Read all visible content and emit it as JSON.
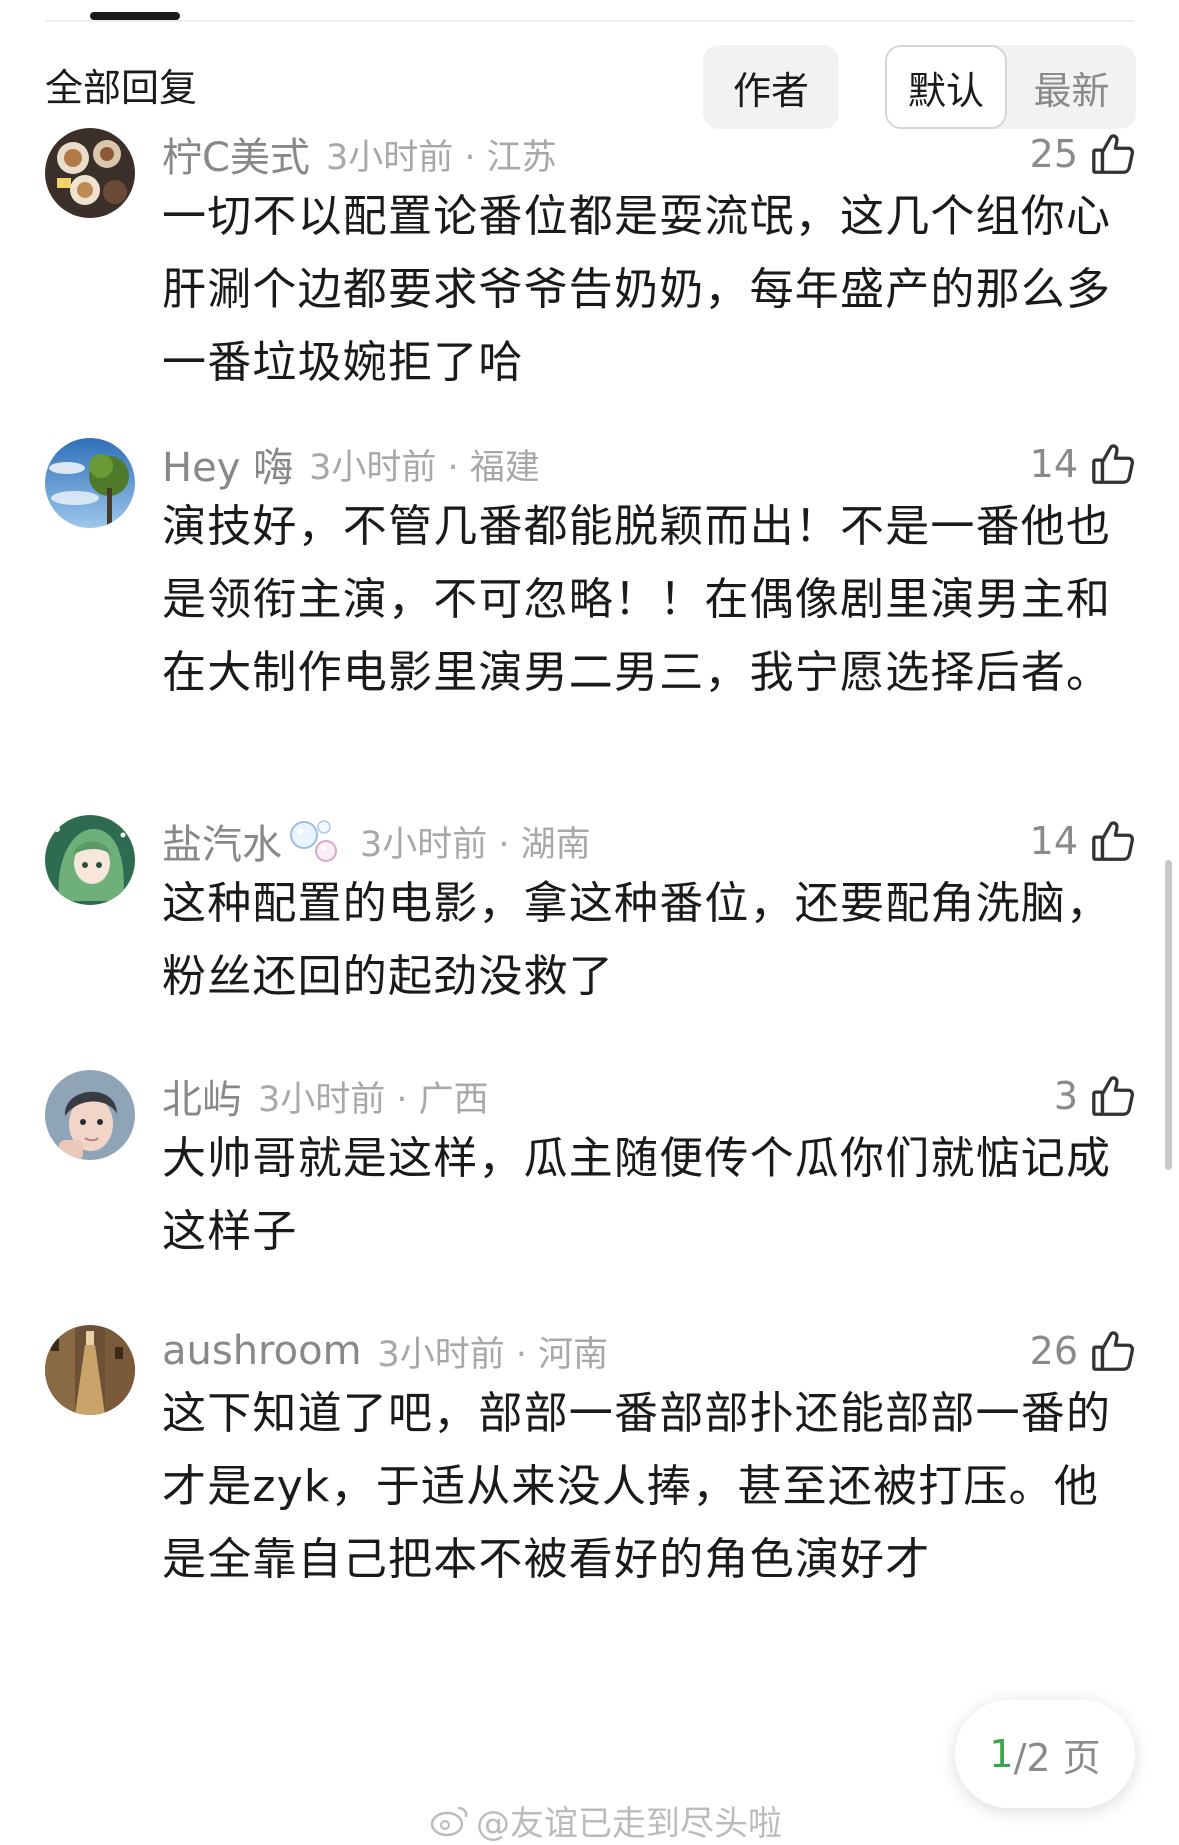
{
  "header": {
    "title": "全部回复",
    "author_btn": "作者",
    "sort_default": "默认",
    "sort_latest": "最新"
  },
  "comments": [
    {
      "username": "柠C美式",
      "time_location": "3小时前 · 江苏",
      "likes": "25",
      "text": "一切不以配置论番位都是耍流氓，这几个组你心肝涮个边都要求爷爷告奶奶，每年盛产的那么多一番垃圾婉拒了哈",
      "avatar_icon": "coffee-avatar-icon"
    },
    {
      "username": "Hey 嗨",
      "time_location": "3小时前 · 福建",
      "likes": "14",
      "text": "演技好，不管几番都能脱颖而出！不是一番他也是领衔主演，不可忽略！！在偶像剧里演男主和在大制作电影里演男二男三，我宁愿选择后者。",
      "avatar_icon": "tree-sky-avatar-icon"
    },
    {
      "username": "盐汽水",
      "time_location": "3小时前 · 湖南",
      "likes": "14",
      "text": "这种配置的电影，拿这种番位，还要配角洗脑，粉丝还回的起劲没救了",
      "avatar_icon": "anime-girl-avatar-icon"
    },
    {
      "username": "北屿",
      "time_location": "3小时前 · 广西",
      "likes": "3",
      "text": "大帅哥就是这样，瓜主随便传个瓜你们就惦记成这样子",
      "avatar_icon": "portrait-avatar-icon"
    },
    {
      "username": "aushroom",
      "time_location": "3小时前 · 河南",
      "likes": "26",
      "text": "这下知道了吧，部部一番部部扑还能部部一番的才是zyk，于适从来没人捧，甚至还被打压。他是全靠自己把本不被看好的角色演好才",
      "avatar_icon": "street-avatar-icon"
    }
  ],
  "pager": {
    "current": "1",
    "total": "/2 页"
  },
  "watermark": {
    "text": "@友谊已走到尽头啦",
    "icon": "weibo-logo-icon"
  }
}
